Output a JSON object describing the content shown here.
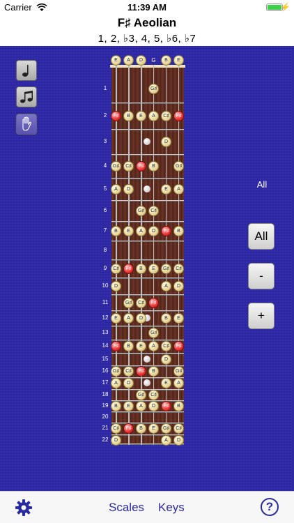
{
  "status_bar": {
    "carrier": "Carrier",
    "time": "11:39 AM"
  },
  "scale": {
    "title": "F♯ Aeolian",
    "formula": "1, 2, ♭3, 4, 5, ♭6, ♭7"
  },
  "strings": [
    "E",
    "A",
    "D",
    "G",
    "B",
    "E"
  ],
  "open_notes": [
    {
      "string": 0,
      "note": "E"
    },
    {
      "string": 1,
      "note": "A"
    },
    {
      "string": 2,
      "note": "D"
    },
    {
      "string": 4,
      "note": "B"
    },
    {
      "string": 5,
      "note": "E"
    }
  ],
  "frets": [
    {
      "fret": "1",
      "notes": [
        {
          "s": 3,
          "n": "G♯"
        }
      ]
    },
    {
      "fret": "2",
      "notes": [
        {
          "s": 0,
          "n": "F♯",
          "root": true
        },
        {
          "s": 1,
          "n": "B"
        },
        {
          "s": 2,
          "n": "E"
        },
        {
          "s": 3,
          "n": "A"
        },
        {
          "s": 4,
          "n": "C♯"
        },
        {
          "s": 5,
          "n": "F♯",
          "root": true
        }
      ]
    },
    {
      "fret": "3",
      "notes": [
        {
          "s": 4,
          "n": "D"
        }
      ]
    },
    {
      "fret": "4",
      "notes": [
        {
          "s": 0,
          "n": "G♯"
        },
        {
          "s": 1,
          "n": "C♯"
        },
        {
          "s": 2,
          "n": "F♯",
          "root": true
        },
        {
          "s": 3,
          "n": "B"
        },
        {
          "s": 5,
          "n": "G♯"
        }
      ]
    },
    {
      "fret": "5",
      "notes": [
        {
          "s": 0,
          "n": "A"
        },
        {
          "s": 1,
          "n": "D"
        },
        {
          "s": 4,
          "n": "E"
        },
        {
          "s": 5,
          "n": "A"
        }
      ]
    },
    {
      "fret": "6",
      "notes": [
        {
          "s": 2,
          "n": "G♯"
        },
        {
          "s": 3,
          "n": "C♯"
        }
      ]
    },
    {
      "fret": "7",
      "notes": [
        {
          "s": 0,
          "n": "B"
        },
        {
          "s": 1,
          "n": "E"
        },
        {
          "s": 2,
          "n": "A"
        },
        {
          "s": 3,
          "n": "D"
        },
        {
          "s": 4,
          "n": "F♯",
          "root": true
        },
        {
          "s": 5,
          "n": "B"
        }
      ]
    },
    {
      "fret": "8",
      "notes": []
    },
    {
      "fret": "9",
      "notes": [
        {
          "s": 0,
          "n": "C♯"
        },
        {
          "s": 1,
          "n": "F♯",
          "root": true
        },
        {
          "s": 2,
          "n": "B"
        },
        {
          "s": 3,
          "n": "E"
        },
        {
          "s": 4,
          "n": "G♯"
        },
        {
          "s": 5,
          "n": "C♯"
        }
      ]
    },
    {
      "fret": "10",
      "notes": [
        {
          "s": 0,
          "n": "D"
        },
        {
          "s": 4,
          "n": "A"
        },
        {
          "s": 5,
          "n": "D"
        }
      ]
    },
    {
      "fret": "11",
      "notes": [
        {
          "s": 1,
          "n": "G♯"
        },
        {
          "s": 2,
          "n": "C♯"
        },
        {
          "s": 3,
          "n": "F♯",
          "root": true
        }
      ]
    },
    {
      "fret": "12",
      "notes": [
        {
          "s": 0,
          "n": "E"
        },
        {
          "s": 1,
          "n": "A"
        },
        {
          "s": 2,
          "n": "D"
        },
        {
          "s": 4,
          "n": "B"
        },
        {
          "s": 5,
          "n": "E"
        }
      ]
    },
    {
      "fret": "13",
      "notes": [
        {
          "s": 3,
          "n": "G♯"
        }
      ]
    },
    {
      "fret": "14",
      "notes": [
        {
          "s": 0,
          "n": "F♯",
          "root": true
        },
        {
          "s": 1,
          "n": "B"
        },
        {
          "s": 2,
          "n": "E"
        },
        {
          "s": 3,
          "n": "A"
        },
        {
          "s": 4,
          "n": "C♯"
        },
        {
          "s": 5,
          "n": "F♯",
          "root": true
        }
      ]
    },
    {
      "fret": "15",
      "notes": [
        {
          "s": 4,
          "n": "D"
        }
      ]
    },
    {
      "fret": "16",
      "notes": [
        {
          "s": 0,
          "n": "G♯"
        },
        {
          "s": 1,
          "n": "C♯"
        },
        {
          "s": 2,
          "n": "F♯",
          "root": true
        },
        {
          "s": 3,
          "n": "B"
        },
        {
          "s": 5,
          "n": "G♯"
        }
      ]
    },
    {
      "fret": "17",
      "notes": [
        {
          "s": 0,
          "n": "A"
        },
        {
          "s": 1,
          "n": "D"
        },
        {
          "s": 4,
          "n": "E"
        },
        {
          "s": 5,
          "n": "A"
        }
      ]
    },
    {
      "fret": "18",
      "notes": [
        {
          "s": 2,
          "n": "G♯"
        },
        {
          "s": 3,
          "n": "C♯"
        }
      ]
    },
    {
      "fret": "19",
      "notes": [
        {
          "s": 0,
          "n": "B"
        },
        {
          "s": 1,
          "n": "E"
        },
        {
          "s": 2,
          "n": "A"
        },
        {
          "s": 3,
          "n": "D"
        },
        {
          "s": 4,
          "n": "F♯",
          "root": true
        },
        {
          "s": 5,
          "n": "B"
        }
      ]
    },
    {
      "fret": "20",
      "notes": []
    },
    {
      "fret": "21",
      "notes": [
        {
          "s": 0,
          "n": "C♯"
        },
        {
          "s": 1,
          "n": "F♯",
          "root": true
        },
        {
          "s": 2,
          "n": "B"
        },
        {
          "s": 3,
          "n": "E"
        },
        {
          "s": 4,
          "n": "G♯"
        },
        {
          "s": 5,
          "n": "C♯"
        }
      ]
    },
    {
      "fret": "22",
      "notes": [
        {
          "s": 0,
          "n": "D"
        },
        {
          "s": 4,
          "n": "A"
        },
        {
          "s": 5,
          "n": "D"
        }
      ]
    }
  ],
  "controls": {
    "range_label": "All",
    "all_button": "All",
    "minus_button": "-",
    "plus_button": "+"
  },
  "mode_buttons": [
    {
      "icon": "single-note-icon"
    },
    {
      "icon": "double-note-icon"
    },
    {
      "icon": "hand-icon"
    }
  ],
  "tab_bar": {
    "scales": "Scales",
    "keys": "Keys",
    "help": "?"
  },
  "colors": {
    "background": "#2d27a4",
    "root_note": "#ea3232",
    "tab_accent": "#2b2ba0"
  }
}
